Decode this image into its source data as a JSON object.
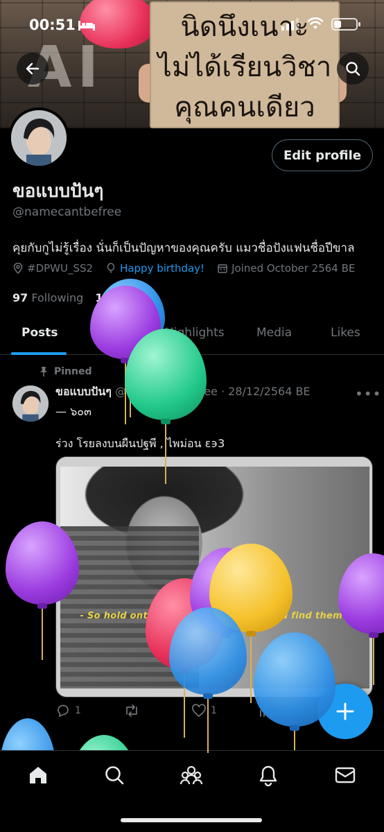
{
  "status_bar": {
    "time": "00:51"
  },
  "banner": {
    "sign_lines": [
      "นิดนึงเนาะ",
      "ไม่ได้เรียนวิชา",
      "คุณคนเดียว"
    ],
    "letters": "AI"
  },
  "profile": {
    "edit_button": "Edit profile",
    "display_name": "ขอแบบปันๆ",
    "handle": "@namecantbefree",
    "bio": "คุยกับกูไม่รู้เรื่อง นั่นก็เป็นปัญหาของคุณครับ แมวชื่อปังแฟนชื่อปีขาล",
    "location": "#DPWU_SS2",
    "birthday_link": "Happy birthday!",
    "joined": "Joined October 2564 BE",
    "following_count": "97",
    "following_label": "Following",
    "followers_count_partial": "10"
  },
  "tabs": [
    {
      "label": "Posts",
      "active": true
    },
    {
      "label": "Replies",
      "active": false
    },
    {
      "label": "Highlights",
      "active": false
    },
    {
      "label": "Media",
      "active": false
    },
    {
      "label": "Likes",
      "active": false
    }
  ],
  "post": {
    "pinned_label": "Pinned",
    "author": "ขอแบบปันๆ",
    "meta": "@namecantbefree · 28/12/2564 BE",
    "subline": "— ๖๐๓",
    "text": "ร่วง โรยลงบนผืนปฐพี , ไพม่อน ε϶3",
    "image_caption": "- So hold onto someone good when you find them -",
    "replies": "1",
    "likes": "1"
  },
  "nav": [
    "home-icon",
    "search-icon",
    "communities-icon",
    "notifications-icon",
    "messages-icon"
  ],
  "colors": {
    "accent": "#1d9bf0",
    "background": "#000000",
    "muted_text": "#71767b",
    "balloon_purple": "#9b3be0",
    "balloon_green": "#22c98a",
    "balloon_blue": "#2d8fe6",
    "balloon_yellow": "#f5c12a",
    "balloon_pink": "#e8315a"
  }
}
